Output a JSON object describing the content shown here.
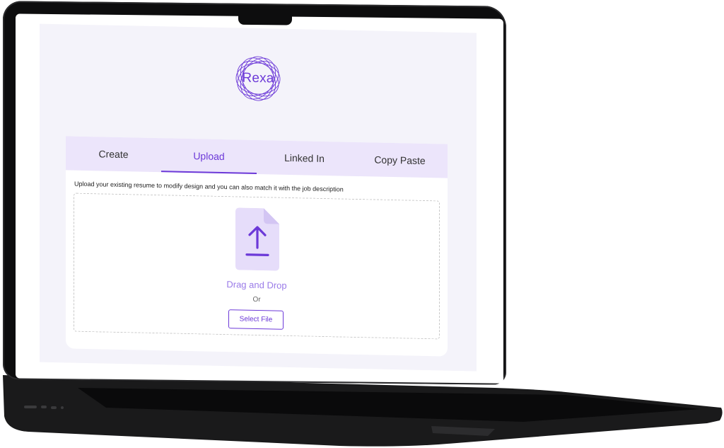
{
  "app": {
    "logo_text": "Rexa",
    "accent_color": "#6c39d8"
  },
  "tabs": [
    {
      "label": "Create",
      "active": false
    },
    {
      "label": "Upload",
      "active": true
    },
    {
      "label": "Linked In",
      "active": false
    },
    {
      "label": "Copy Paste",
      "active": false
    }
  ],
  "upload": {
    "description": "Upload your existing resume to modify design and you can also match it with the job description",
    "drag_text": "Drag and Drop",
    "or_text": "Or",
    "select_button": "Select File",
    "icon": "file-upload-icon"
  }
}
